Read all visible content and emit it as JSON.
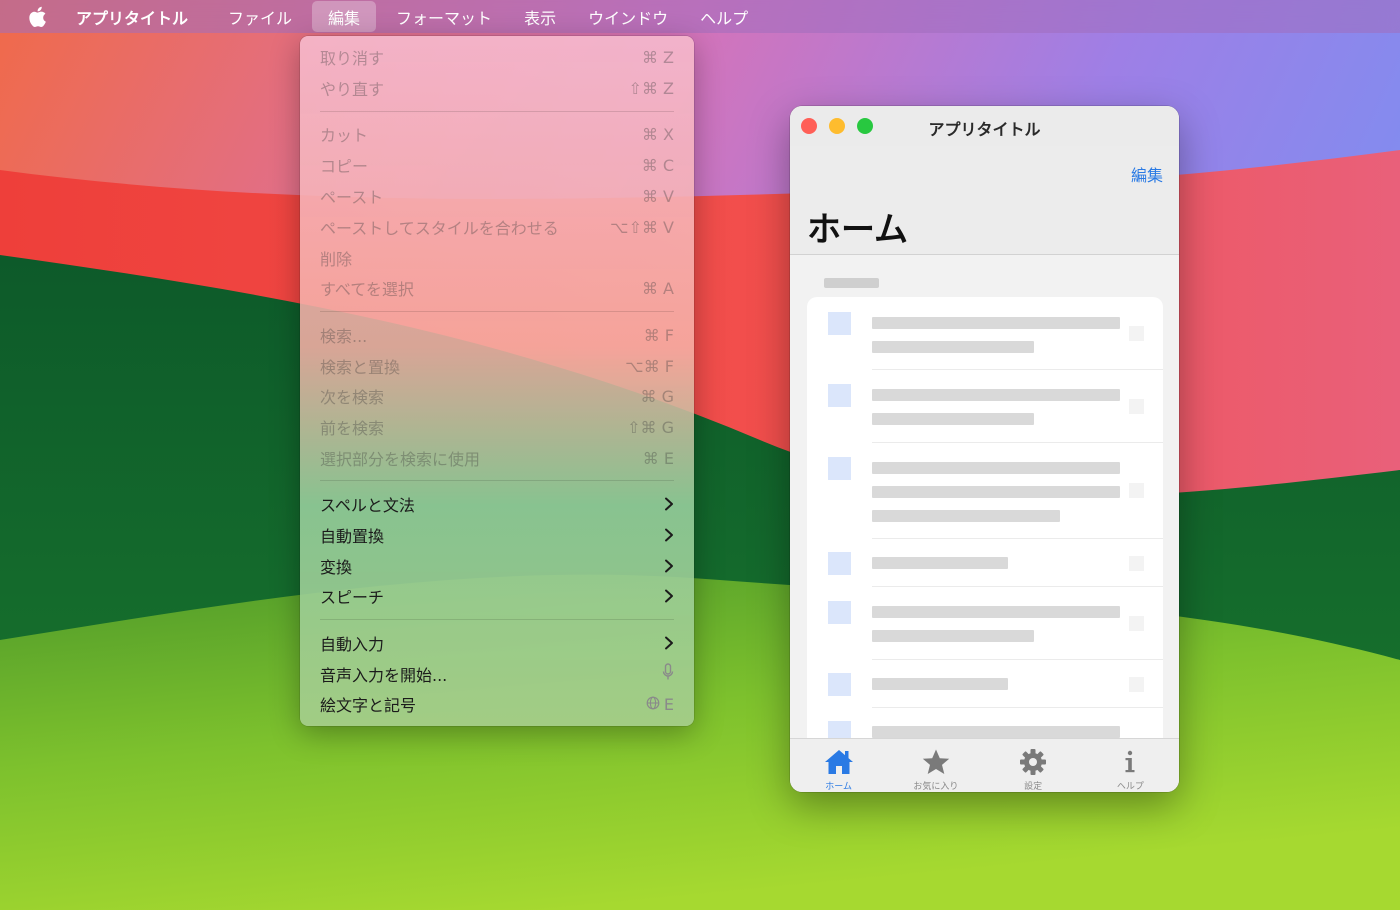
{
  "menubar": {
    "app_name": "アプリタイトル",
    "items": [
      "ファイル",
      "編集",
      "フォーマット",
      "表示",
      "ウインドウ",
      "ヘルプ"
    ],
    "active_item": "編集"
  },
  "edit_menu": {
    "items": [
      {
        "label": "取り消す",
        "shortcut": "⌘ Z",
        "enabled": false
      },
      {
        "label": "やり直す",
        "shortcut": "⇧⌘ Z",
        "enabled": false
      },
      {
        "label": "カット",
        "shortcut": "⌘ X",
        "enabled": false
      },
      {
        "label": "コピー",
        "shortcut": "⌘ C",
        "enabled": false
      },
      {
        "label": "ペースト",
        "shortcut": "⌘ V",
        "enabled": false
      },
      {
        "label": "ペーストしてスタイルを合わせる",
        "shortcut": "⌥⇧⌘ V",
        "enabled": false
      },
      {
        "label": "削除",
        "shortcut": "",
        "enabled": false
      },
      {
        "label": "すべてを選択",
        "shortcut": "⌘ A",
        "enabled": false
      },
      {
        "label": "検索...",
        "shortcut": "⌘ F",
        "enabled": false
      },
      {
        "label": "検索と置換",
        "shortcut": "⌥⌘ F",
        "enabled": false
      },
      {
        "label": "次を検索",
        "shortcut": "⌘ G",
        "enabled": false
      },
      {
        "label": "前を検索",
        "shortcut": "⇧⌘ G",
        "enabled": false
      },
      {
        "label": "選択部分を検索に使用",
        "shortcut": "⌘ E",
        "enabled": false
      },
      {
        "label": "スペルと文法",
        "submenu": true,
        "enabled": true
      },
      {
        "label": "自動置換",
        "submenu": true,
        "enabled": true
      },
      {
        "label": "変換",
        "submenu": true,
        "enabled": true
      },
      {
        "label": "スピーチ",
        "submenu": true,
        "enabled": true
      },
      {
        "label": "自動入力",
        "submenu": true,
        "enabled": true
      },
      {
        "label": "音声入力を開始...",
        "icon": "microphone-icon",
        "enabled": true
      },
      {
        "label": "絵文字と記号",
        "shortcut": "E",
        "icon": "globe-icon",
        "enabled": true
      }
    ]
  },
  "window": {
    "title": "アプリタイトル",
    "edit_button": "編集",
    "large_title": "ホーム",
    "tabs": [
      {
        "label": "ホーム",
        "icon": "house-icon",
        "active": true
      },
      {
        "label": "お気に入り",
        "icon": "star-icon",
        "active": false
      },
      {
        "label": "設定",
        "icon": "gear-icon",
        "active": false
      },
      {
        "label": "ヘルプ",
        "icon": "info-icon",
        "active": false
      }
    ]
  },
  "colors": {
    "accent": "#2a7ae4",
    "close": "#ff5f57",
    "minimize": "#febc2e",
    "zoom": "#28c840"
  }
}
